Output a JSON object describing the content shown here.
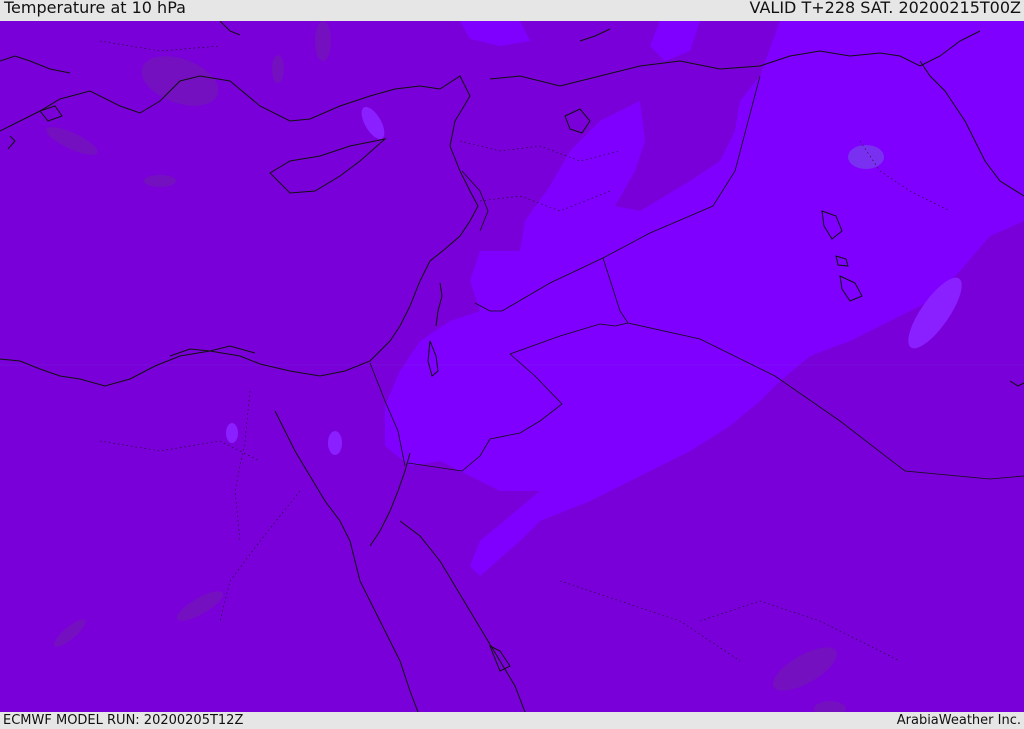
{
  "header": {
    "title": "Temperature at 10 hPa",
    "valid": "VALID T+228 SAT. 20200215T00Z"
  },
  "footer": {
    "model_run": "ECMWF MODEL RUN: 20200205T12Z",
    "credit": "ArabiaWeather Inc."
  },
  "map": {
    "colors": {
      "base_field": "#7a00d9",
      "warm_band": "#7f00ff",
      "cold_patch": "#7a10c8",
      "highlight": "#7730f0",
      "coastline": "#111111"
    }
  }
}
